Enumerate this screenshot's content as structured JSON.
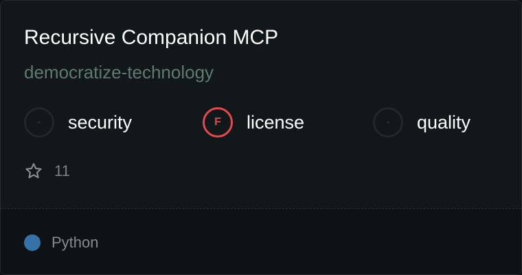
{
  "repo": {
    "name": "Recursive Companion MCP",
    "owner": "democratize-technology",
    "stars": "11"
  },
  "metrics": [
    {
      "grade": "-",
      "label": "security",
      "status": "none"
    },
    {
      "grade": "F",
      "label": "license",
      "status": "fail"
    },
    {
      "grade": "-",
      "label": "quality",
      "status": "none"
    }
  ],
  "language": {
    "name": "Python",
    "color": "#3572a5"
  },
  "colors": {
    "fail": "#e5484d",
    "owner_text": "#5f7a6e"
  },
  "icons": {
    "star": "star-outline-icon"
  }
}
